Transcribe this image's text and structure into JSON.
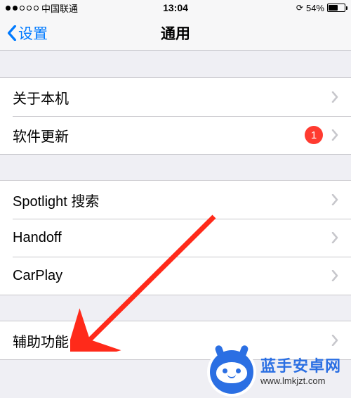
{
  "status": {
    "carrier": "中国联通",
    "time": "13:04",
    "battery_pct": "54%",
    "battery_fill_width": "54%"
  },
  "nav": {
    "back_label": "设置",
    "title": "通用"
  },
  "group1": {
    "about": "关于本机",
    "software_update": "软件更新",
    "update_badge": "1"
  },
  "group2": {
    "spotlight": "Spotlight 搜索",
    "handoff": "Handoff",
    "carplay": "CarPlay"
  },
  "group3": {
    "accessibility": "辅助功能"
  },
  "watermark": {
    "line1": "蓝手安卓网",
    "line2": "www.lmkjzt.com"
  }
}
